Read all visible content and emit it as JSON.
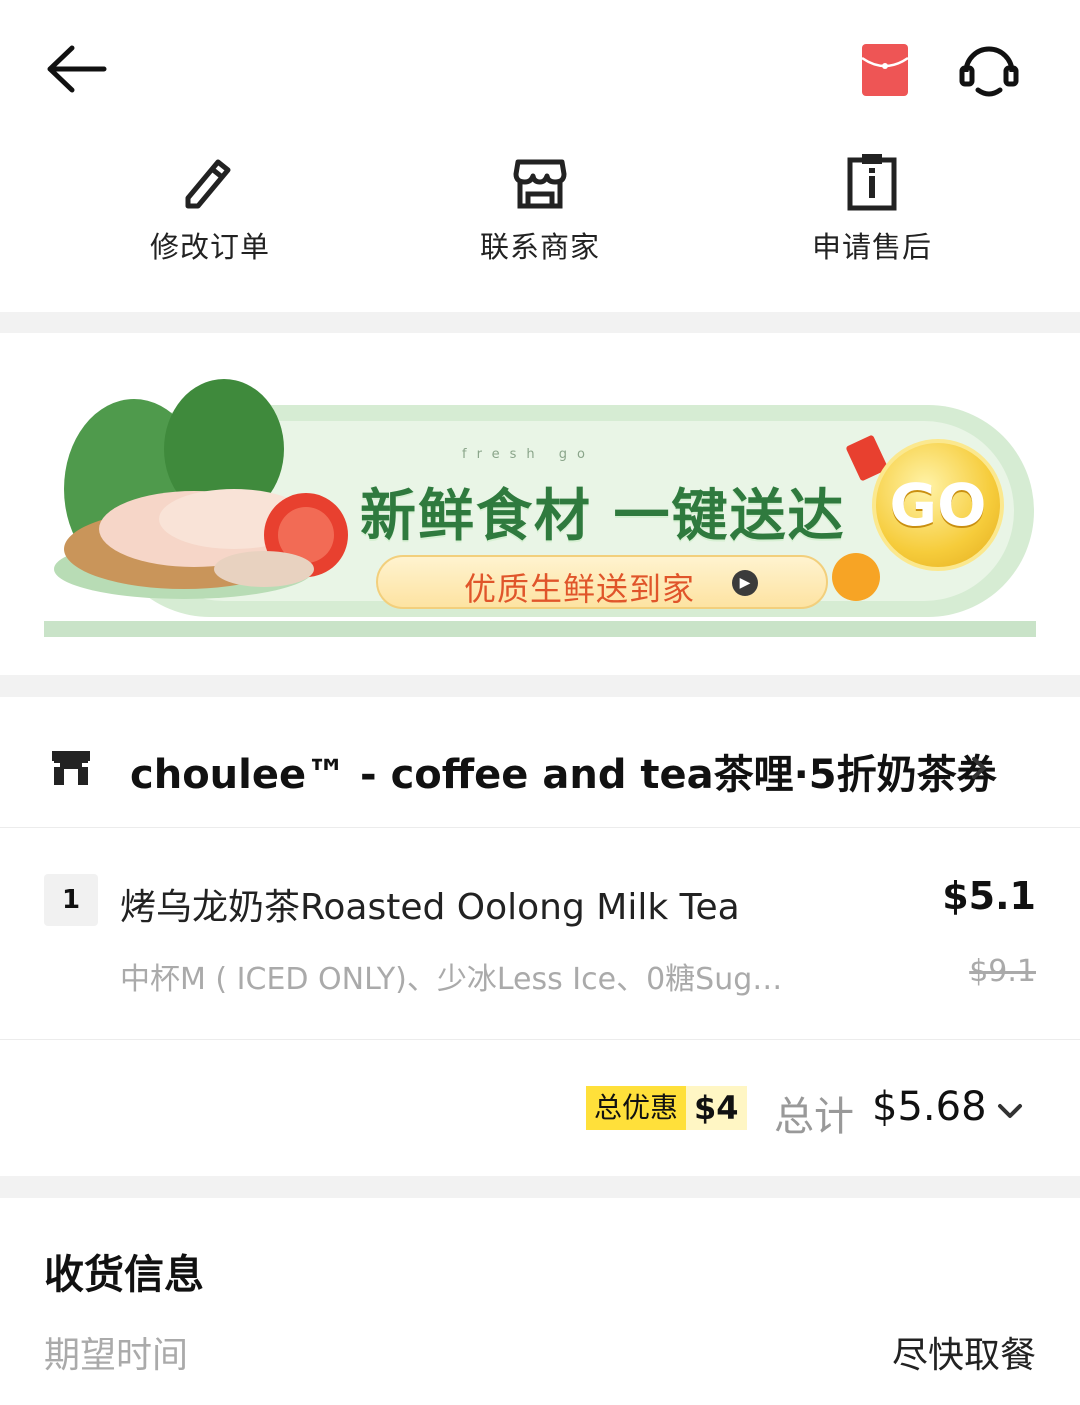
{
  "header": {
    "back_icon": "arrow-left-icon",
    "redpacket_icon": "red-envelope-icon",
    "service_icon": "headset-icon"
  },
  "actions": [
    {
      "label": "修改订单",
      "icon": "pencil-icon"
    },
    {
      "label": "联系商家",
      "icon": "store-icon"
    },
    {
      "label": "申请售后",
      "icon": "clipboard-info-icon"
    }
  ],
  "banner": {
    "sub": "fresh  go",
    "title": "新鲜食材 一键送达",
    "pill_text": "优质生鲜送到家",
    "go_text": "GO",
    "accent": "#2f7a3e"
  },
  "store": {
    "name": "choulee™ - coffee and tea茶哩·5折奶茶券",
    "icon": "shop-icon"
  },
  "item": {
    "qty": "1",
    "name": "烤乌龙奶茶Roasted Oolong Milk Tea",
    "price": "$5.1",
    "options": "中杯M ( ICED ONLY)、少冰Less Ice、0糖Sug…",
    "original_price": "$9.1"
  },
  "total": {
    "discount_label": "总优惠",
    "discount_amount": "$4",
    "label": "总计",
    "value": "$5.68"
  },
  "delivery": {
    "title": "收货信息",
    "time_label": "期望时间",
    "time_value": "尽快取餐"
  }
}
